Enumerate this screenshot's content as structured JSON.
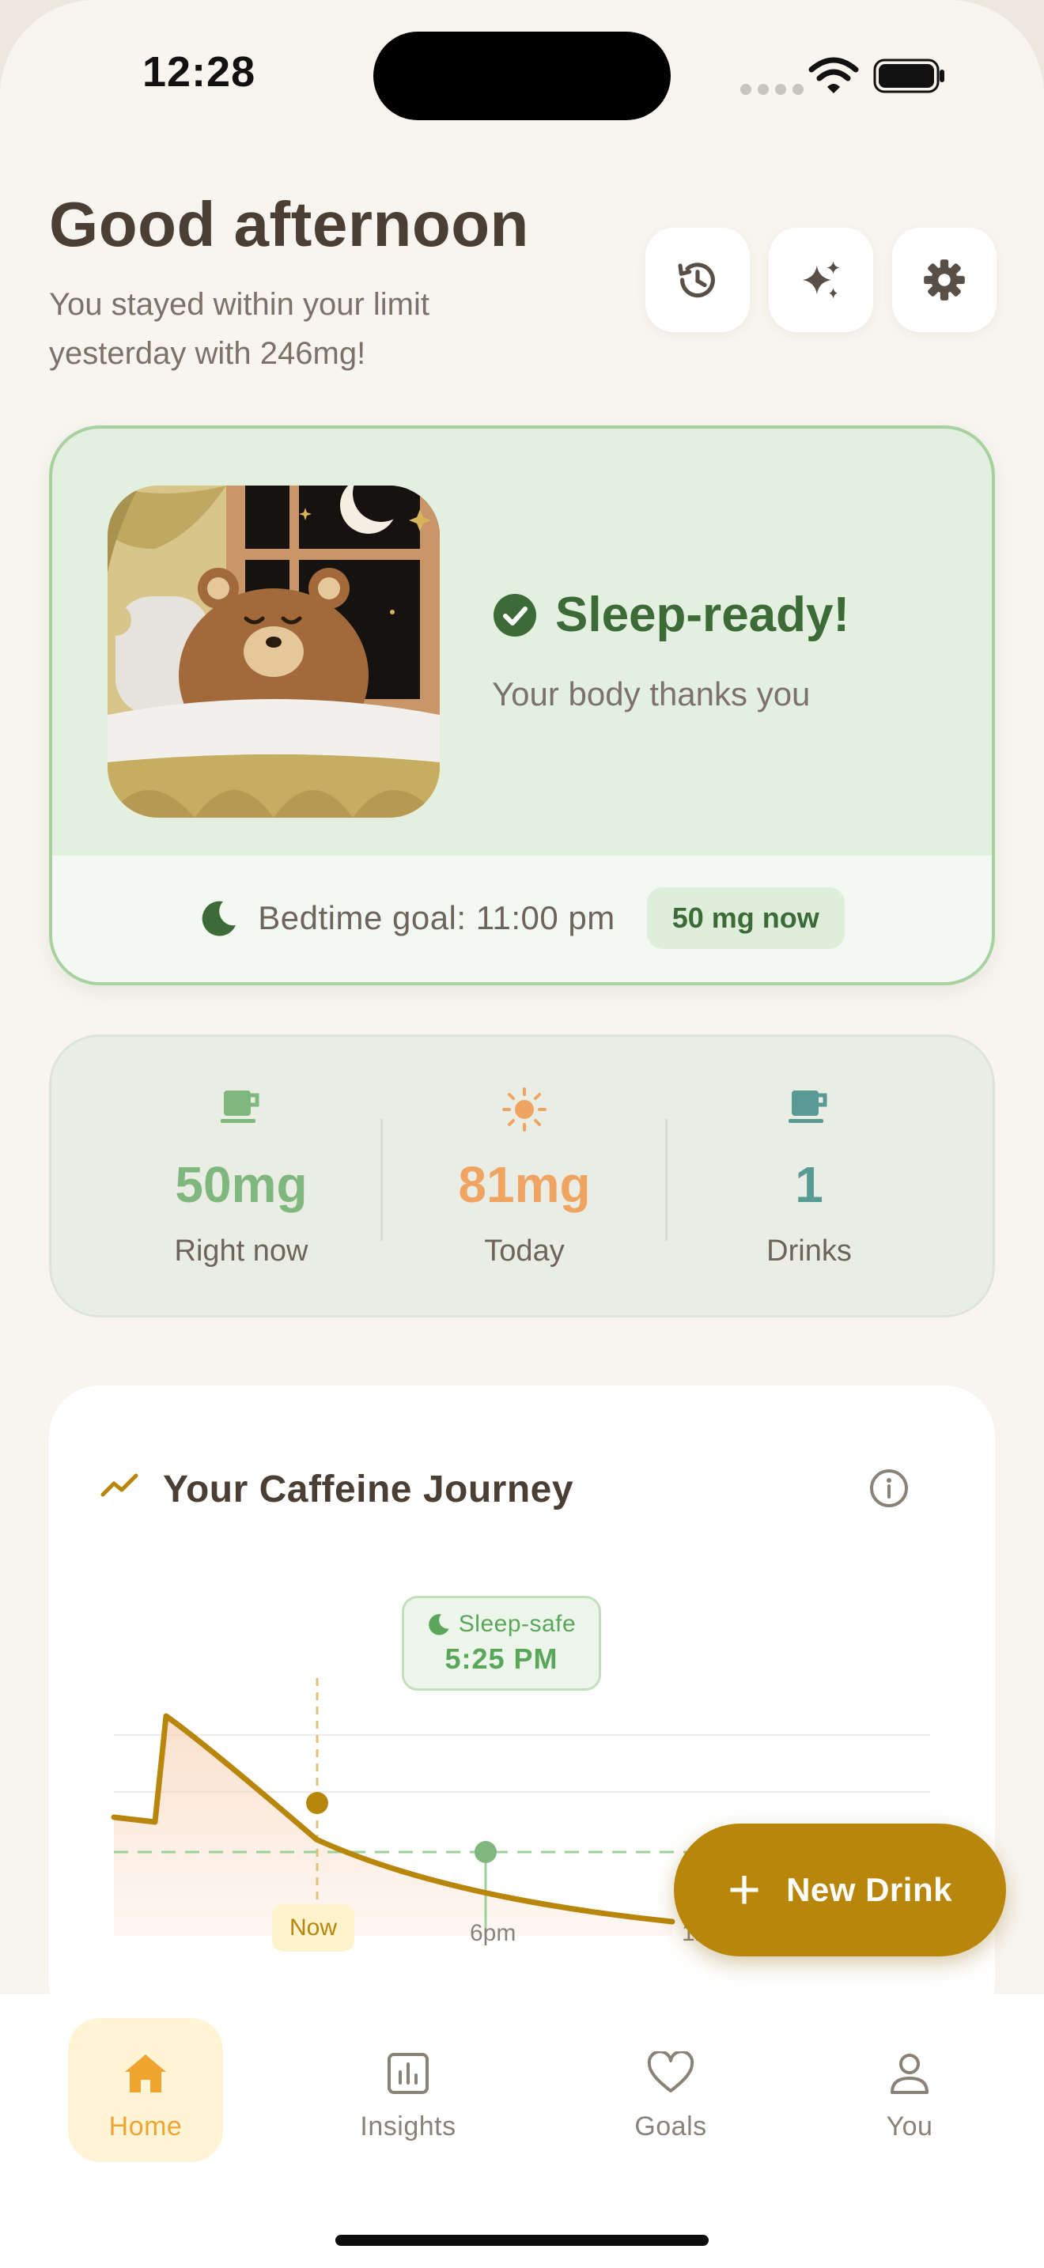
{
  "status_bar": {
    "time": "12:28"
  },
  "header": {
    "greeting": "Good afternoon",
    "subtitle": "You stayed within your limit yesterday with 246mg!"
  },
  "header_buttons": [
    {
      "icon": "history-icon"
    },
    {
      "icon": "sparkles-icon"
    },
    {
      "icon": "gear-icon"
    }
  ],
  "sleep_card": {
    "title": "Sleep-ready!",
    "subtitle": "Your body thanks you",
    "bedtime": "Bedtime goal: 11:00 pm",
    "now_badge": "50 mg now"
  },
  "stats": [
    {
      "value": "50mg",
      "label": "Right now",
      "color": "#7fb77e",
      "icon": "cup-icon"
    },
    {
      "value": "81mg",
      "label": "Today",
      "color": "#f0a462",
      "icon": "sun-icon"
    },
    {
      "value": "1",
      "label": "Drinks",
      "color": "#5a9a94",
      "icon": "cup-icon"
    }
  ],
  "journey": {
    "title": "Your Caffeine Journey",
    "sleep_safe_label": "Sleep-safe",
    "sleep_safe_time": "5:25 PM",
    "now_label": "Now",
    "tick_6pm": "6pm",
    "tick_12": "12"
  },
  "fab": {
    "label": "New Drink"
  },
  "nav": [
    {
      "label": "Home",
      "icon": "house-icon",
      "active": true
    },
    {
      "label": "Insights",
      "icon": "bar-chart-icon",
      "active": false
    },
    {
      "label": "Goals",
      "icon": "heart-icon",
      "active": false
    },
    {
      "label": "You",
      "icon": "person-icon",
      "active": false
    }
  ],
  "colors": {
    "accent": "#b8860b",
    "sleep_green": "#3d6b37",
    "safe_green": "#5aa65a",
    "nav_active": "#f0a531"
  }
}
